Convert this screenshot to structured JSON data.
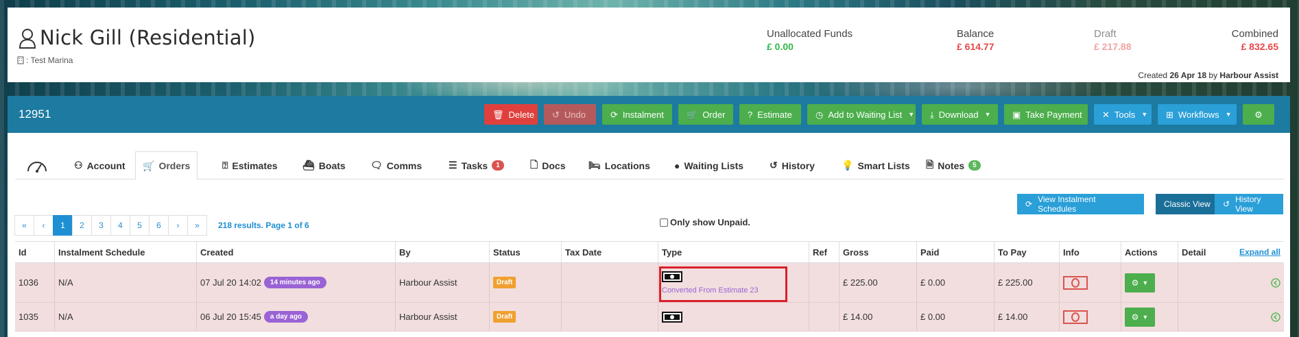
{
  "header": {
    "customer_name": "Nick Gill (Residential)",
    "marina_label": ": Test Marina",
    "stats": {
      "unallocated_label": "Unallocated Funds",
      "unallocated_value": "£ 0.00",
      "balance_label": "Balance",
      "balance_value": "£ 614.77",
      "draft_label": "Draft",
      "draft_value": "£ 217.88",
      "combined_label": "Combined",
      "combined_value": "£ 832.65"
    },
    "created_prefix": "Created",
    "created_date": "26 Apr 18",
    "created_by_prefix": "by",
    "created_by": "Harbour Assist"
  },
  "toolbar": {
    "record_id": "12951",
    "delete": "Delete",
    "undo": "Undo",
    "instalment": "Instalment",
    "order": "Order",
    "estimate": "Estimate",
    "add_waiting": "Add to Waiting List",
    "download": "Download",
    "take_payment": "Take Payment",
    "tools": "Tools",
    "workflows": "Workflows"
  },
  "tabs": {
    "account": "Account",
    "orders": "Orders",
    "estimates": "Estimates",
    "boats": "Boats",
    "comms": "Comms",
    "tasks": "Tasks",
    "tasks_badge": "1",
    "docs": "Docs",
    "locations": "Locations",
    "waiting_lists": "Waiting Lists",
    "history": "History",
    "smart_lists": "Smart Lists",
    "notes": "Notes",
    "notes_badge": "5"
  },
  "actions": {
    "view_instalment_schedules": "View Instalment Schedules",
    "classic_view": "Classic View",
    "history_view": "History View",
    "only_unpaid": "Only show Unpaid."
  },
  "pagination": {
    "first": "«",
    "prev": "‹",
    "pages": [
      "1",
      "2",
      "3",
      "4",
      "5",
      "6"
    ],
    "active_page": "1",
    "next": "›",
    "last": "»",
    "summary": "218 results. Page 1 of 6"
  },
  "table": {
    "columns": {
      "id": "Id",
      "schedule": "Instalment Schedule",
      "created": "Created",
      "by": "By",
      "status": "Status",
      "tax_date": "Tax Date",
      "type": "Type",
      "ref": "Ref",
      "gross": "Gross",
      "paid": "Paid",
      "to_pay": "To Pay",
      "info": "Info",
      "actions": "Actions",
      "detail": "Detail",
      "expand_all": "Expand all"
    },
    "rows": [
      {
        "id": "1036",
        "schedule": "N/A",
        "created": "07 Jul 20 14:02",
        "ago": "14 minutes ago",
        "by": "Harbour Assist",
        "status": "Draft",
        "tax_date": "",
        "type_note": "Converted From Estimate 23",
        "ref": "",
        "gross": "£ 225.00",
        "paid": "£ 0.00",
        "to_pay": "£ 225.00"
      },
      {
        "id": "1035",
        "schedule": "N/A",
        "created": "06 Jul 20 15:45",
        "ago": "a day ago",
        "by": "Harbour Assist",
        "status": "Draft",
        "tax_date": "",
        "type_note": "",
        "ref": "",
        "gross": "£ 14.00",
        "paid": "£ 0.00",
        "to_pay": "£ 14.00"
      }
    ]
  },
  "colors": {
    "toolbar_bg": "#1d7aa1",
    "green_btn": "#4cae4c",
    "red_btn": "#e0403d",
    "blue_btn": "#2a9fd8",
    "draft_row": "#f2dede",
    "purple_pill": "#9a63d5",
    "status_draft": "#f0a030",
    "highlight": "#d91f2b"
  }
}
